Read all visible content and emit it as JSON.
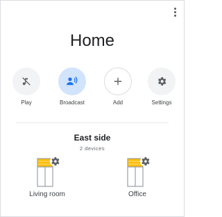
{
  "header": {
    "title": "Home",
    "overflow_icon": "more-vert-icon"
  },
  "actions": [
    {
      "label": "Play",
      "icon": "music-off-icon"
    },
    {
      "label": "Broadcast",
      "icon": "broadcast-icon"
    },
    {
      "label": "Add",
      "icon": "plus-icon"
    },
    {
      "label": "Settings",
      "icon": "gear-icon"
    }
  ],
  "room_group": {
    "title": "East side",
    "subtitle": "2 devices",
    "devices": [
      {
        "label": "Living room",
        "icon": "room-window-gear-icon"
      },
      {
        "label": "Office",
        "icon": "room-window-gear-icon"
      }
    ]
  },
  "colors": {
    "broadcast_accent": "#1a73e8",
    "broadcast_bg": "#d2e3fc",
    "window_yellow": "#fbbc04",
    "icon_grey": "#5f6368"
  }
}
